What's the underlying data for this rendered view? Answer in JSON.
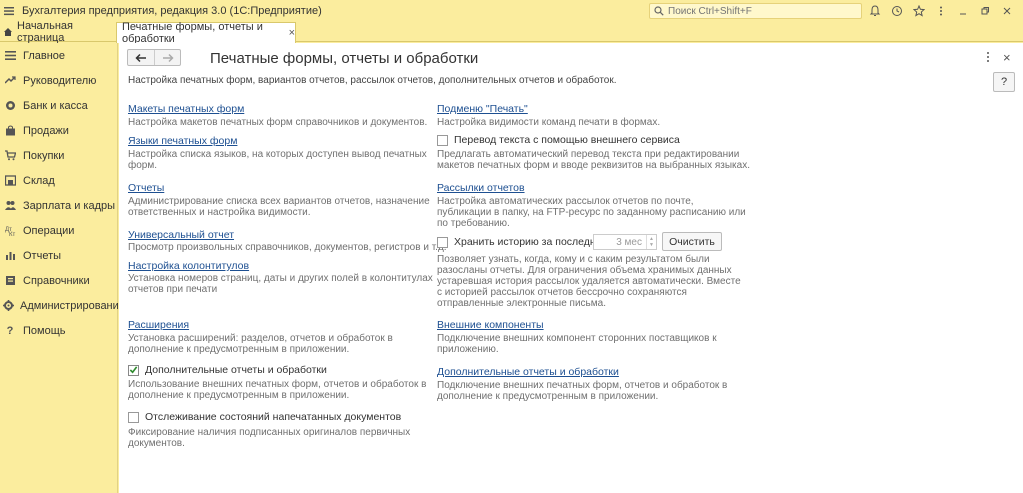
{
  "window": {
    "title": "Бухгалтерия предприятия, редакция 3.0  (1С:Предприятие)",
    "search_placeholder": "Поиск Ctrl+Shift+F"
  },
  "tabs": {
    "home": "Начальная страница",
    "active": "Печатные формы, отчеты и обработки",
    "active_close": "×"
  },
  "sidebar": {
    "items": [
      {
        "label": "Главное",
        "icon": "menu-icon"
      },
      {
        "label": "Руководителю",
        "icon": "trend-icon"
      },
      {
        "label": "Банк и касса",
        "icon": "coins-icon"
      },
      {
        "label": "Продажи",
        "icon": "bag-icon"
      },
      {
        "label": "Покупки",
        "icon": "cart-icon"
      },
      {
        "label": "Склад",
        "icon": "warehouse-icon"
      },
      {
        "label": "Зарплата и кадры",
        "icon": "people-icon"
      },
      {
        "label": "Операции",
        "icon": "operations-icon"
      },
      {
        "label": "Отчеты",
        "icon": "reports-icon"
      },
      {
        "label": "Справочники",
        "icon": "book-icon"
      },
      {
        "label": "Администрирование",
        "icon": "gear-icon"
      },
      {
        "label": "Помощь",
        "icon": "question-icon"
      }
    ]
  },
  "page": {
    "title": "Печатные формы, отчеты и обработки",
    "subtitle": "Настройка печатных форм, вариантов отчетов, рассылок отчетов, дополнительных отчетов и обработок.",
    "help": "?",
    "close": "×"
  },
  "left": {
    "makety": {
      "link": "Макеты печатных форм",
      "desc": "Настройка макетов печатных форм справочников и документов."
    },
    "yazyki": {
      "link": "Языки печатных форм",
      "desc1": "Настройка списка языков, на которых доступен вывод печатных",
      "desc2": "форм."
    },
    "otchety": {
      "link": "Отчеты",
      "desc1": "Администрирование списка всех вариантов отчетов, назначение",
      "desc2": "ответственных и настройка видимости."
    },
    "universal": {
      "link": "Универсальный отчет",
      "desc": "Просмотр произвольных справочников, документов, регистров и т.д."
    },
    "kolontituly": {
      "link": "Настройка колонтитулов",
      "desc1": "Установка номеров страниц, даты и других полей в колонтитулах",
      "desc2": "отчетов при печати"
    },
    "rasshireniya": {
      "link": "Расширения",
      "desc1": "Установка расширений: разделов, отчетов и обработок в",
      "desc2": "дополнение к предусмотренным в приложении."
    },
    "dop_otchety": {
      "label": "Дополнительные отчеты и обработки",
      "checked": true,
      "desc1": "Использование внешних печатных форм, отчетов и обработок в",
      "desc2": "дополнение к предусмотренным в приложении."
    },
    "otslezhivanie": {
      "label": "Отслеживание состояний напечатанных документов",
      "checked": false,
      "desc1": "Фиксирование наличия подписанных оригиналов первичных",
      "desc2": "документов."
    }
  },
  "right": {
    "podmenu": {
      "link": "Подменю \"Печать\"",
      "desc": "Настройка видимости команд печати в формах."
    },
    "perevod": {
      "label": "Перевод текста с помощью внешнего сервиса",
      "checked": false,
      "desc1": "Предлагать автоматический перевод текста при редактировании",
      "desc2": "макетов печатных форм и вводе реквизитов на выбранных языках."
    },
    "rassylki": {
      "link": "Рассылки отчетов",
      "desc1": "Настройка автоматических рассылок отчетов по почте,",
      "desc2": "публикации в папку, на FTP-ресурс по заданному расписанию или",
      "desc3": "по требованию."
    },
    "istoriya": {
      "label": "Хранить историю за последние",
      "checked": false,
      "value": "3 мес",
      "clear_button": "Очистить",
      "desc1": "Позволяет узнать, когда, кому и с каким результатом были",
      "desc2": "разосланы отчеты. Для ограничения объема хранимых данных",
      "desc3": "устаревшая история рассылок удаляется автоматически. Вместе",
      "desc4": "с историей рассылок отчетов бессрочно сохраняются",
      "desc5": "отправленные электронные письма."
    },
    "vneshnie": {
      "link": "Внешние компоненты",
      "desc1": "Подключение внешних компонент сторонних поставщиков к",
      "desc2": "приложению."
    },
    "dop_otchety_link": {
      "link": "Дополнительные отчеты и обработки",
      "desc1": "Подключение внешних печатных форм, отчетов и обработок в",
      "desc2": "дополнение к предусмотренным в приложении."
    }
  },
  "colors": {
    "accent": "#fbed9e",
    "link": "#1d4f91",
    "check": "#2e8b2e"
  }
}
